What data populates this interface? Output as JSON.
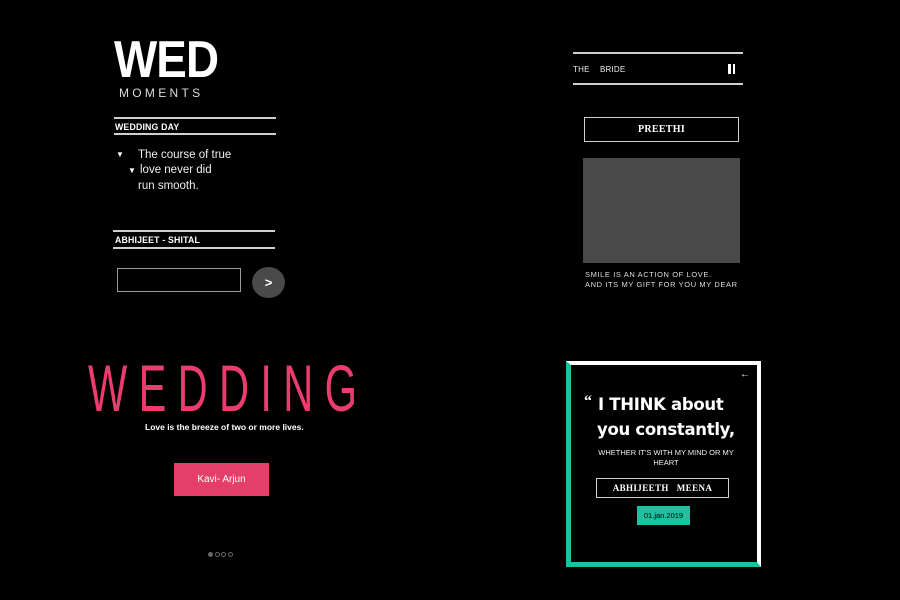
{
  "brand": {
    "title": "WED",
    "subtitle": "MOMENTS"
  },
  "wedding_day": {
    "label": "WEDDING DAY",
    "quote_lines": [
      "The course of true",
      "love never did",
      "run smooth."
    ],
    "bullet_icon": "triangle-down-icon"
  },
  "couple_section": {
    "label": "ABHIJEET - SHITAL",
    "input_value": "",
    "input_placeholder": "",
    "go_button_label": ">"
  },
  "bride_panel": {
    "bar_label_1": "THE",
    "bar_label_2": "BRIDE",
    "pause_icon": "pause-icon",
    "name": "PREETHI",
    "caption_lines": [
      "SMILE IS AN ACTION OF LOVE.",
      "AND ITS MY GIFT FOR YOU MY DEAR"
    ]
  },
  "hero": {
    "title": "WEDDING",
    "tagline": "Love is the breeze of two or more lives.",
    "cta_label": "Kavi- Arjun",
    "carousel": {
      "total": 4,
      "active": 1
    }
  },
  "quote_card": {
    "back_icon": "arrow-left-icon",
    "quote_mark": "“",
    "headline_1": "I THINK about",
    "headline_2": "you constantly,",
    "sub": "WHETHER IT'S WITH MY MIND OR MY HEART",
    "names": "ABHIJEETH   MEENA",
    "date": "01.jan.2019"
  },
  "colors": {
    "accent_pink": "#ea3d6e",
    "accent_teal": "#1ec0a0",
    "background": "#000000",
    "photo_placeholder": "#494949"
  }
}
